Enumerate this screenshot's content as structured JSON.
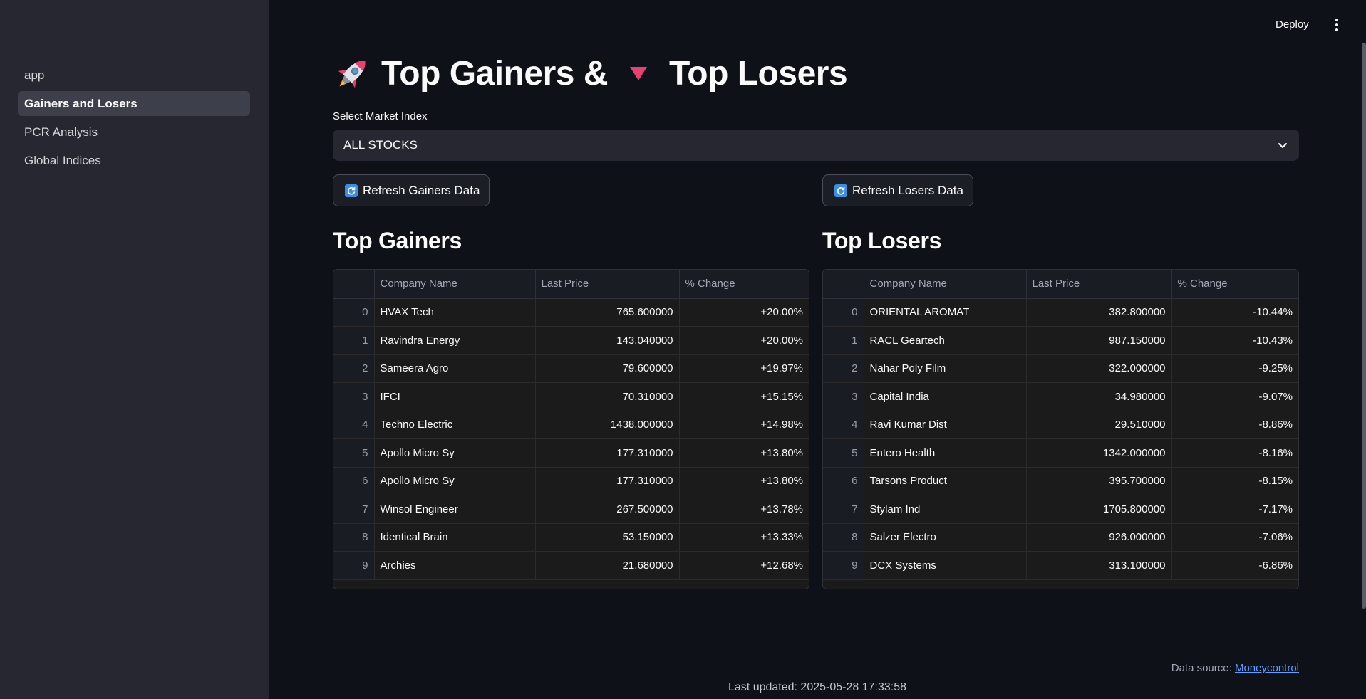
{
  "sidebar": {
    "items": [
      {
        "label": "app"
      },
      {
        "label": "Gainers and Losers"
      },
      {
        "label": "PCR Analysis"
      },
      {
        "label": "Global Indices"
      }
    ]
  },
  "header": {
    "deploy_label": "Deploy",
    "menu_icon": "kebab-menu-icon"
  },
  "title": {
    "part1": "Top Gainers &",
    "part2": "Top Losers",
    "rocket_icon": "rocket-icon",
    "down_icon": "red-triangle-down-icon"
  },
  "market_select": {
    "label": "Select Market Index",
    "value": "ALL STOCKS"
  },
  "buttons": {
    "refresh_gainers": "Refresh Gainers Data",
    "refresh_losers": "Refresh Losers Data"
  },
  "colors": {
    "accent_triangle": "#e8416f",
    "refresh_icon": "#3b8ee0",
    "link": "#5aa0ff"
  },
  "gainers": {
    "title": "Top Gainers",
    "columns": [
      "",
      "Company Name",
      "Last Price",
      "% Change"
    ],
    "rows": [
      {
        "i": "0",
        "name": "HVAX Tech",
        "price": "765.600000",
        "change": "+20.00%"
      },
      {
        "i": "1",
        "name": "Ravindra Energy",
        "price": "143.040000",
        "change": "+20.00%"
      },
      {
        "i": "2",
        "name": "Sameera Agro",
        "price": "79.600000",
        "change": "+19.97%"
      },
      {
        "i": "3",
        "name": "IFCI",
        "price": "70.310000",
        "change": "+15.15%"
      },
      {
        "i": "4",
        "name": "Techno Electric",
        "price": "1438.000000",
        "change": "+14.98%"
      },
      {
        "i": "5",
        "name": "Apollo Micro Sy",
        "price": "177.310000",
        "change": "+13.80%"
      },
      {
        "i": "6",
        "name": "Apollo Micro Sy",
        "price": "177.310000",
        "change": "+13.80%"
      },
      {
        "i": "7",
        "name": "Winsol Engineer",
        "price": "267.500000",
        "change": "+13.78%"
      },
      {
        "i": "8",
        "name": "Identical Brain",
        "price": "53.150000",
        "change": "+13.33%"
      },
      {
        "i": "9",
        "name": "Archies",
        "price": "21.680000",
        "change": "+12.68%"
      }
    ]
  },
  "losers": {
    "title": "Top Losers",
    "columns": [
      "",
      "Company Name",
      "Last Price",
      "% Change"
    ],
    "rows": [
      {
        "i": "0",
        "name": "ORIENTAL AROMAT",
        "price": "382.800000",
        "change": "-10.44%"
      },
      {
        "i": "1",
        "name": "RACL Geartech",
        "price": "987.150000",
        "change": "-10.43%"
      },
      {
        "i": "2",
        "name": "Nahar Poly Film",
        "price": "322.000000",
        "change": "-9.25%"
      },
      {
        "i": "3",
        "name": "Capital India",
        "price": "34.980000",
        "change": "-9.07%"
      },
      {
        "i": "4",
        "name": "Ravi Kumar Dist",
        "price": "29.510000",
        "change": "-8.86%"
      },
      {
        "i": "5",
        "name": "Entero Health",
        "price": "1342.000000",
        "change": "-8.16%"
      },
      {
        "i": "6",
        "name": "Tarsons Product",
        "price": "395.700000",
        "change": "-8.15%"
      },
      {
        "i": "7",
        "name": "Stylam Ind",
        "price": "1705.800000",
        "change": "-7.17%"
      },
      {
        "i": "8",
        "name": "Salzer Electro",
        "price": "926.000000",
        "change": "-7.06%"
      },
      {
        "i": "9",
        "name": "DCX Systems",
        "price": "313.100000",
        "change": "-6.86%"
      }
    ]
  },
  "footer": {
    "source_label": "Data source:",
    "source_link": "Moneycontrol",
    "updated": "Last updated: 2025-05-28 17:33:58"
  }
}
